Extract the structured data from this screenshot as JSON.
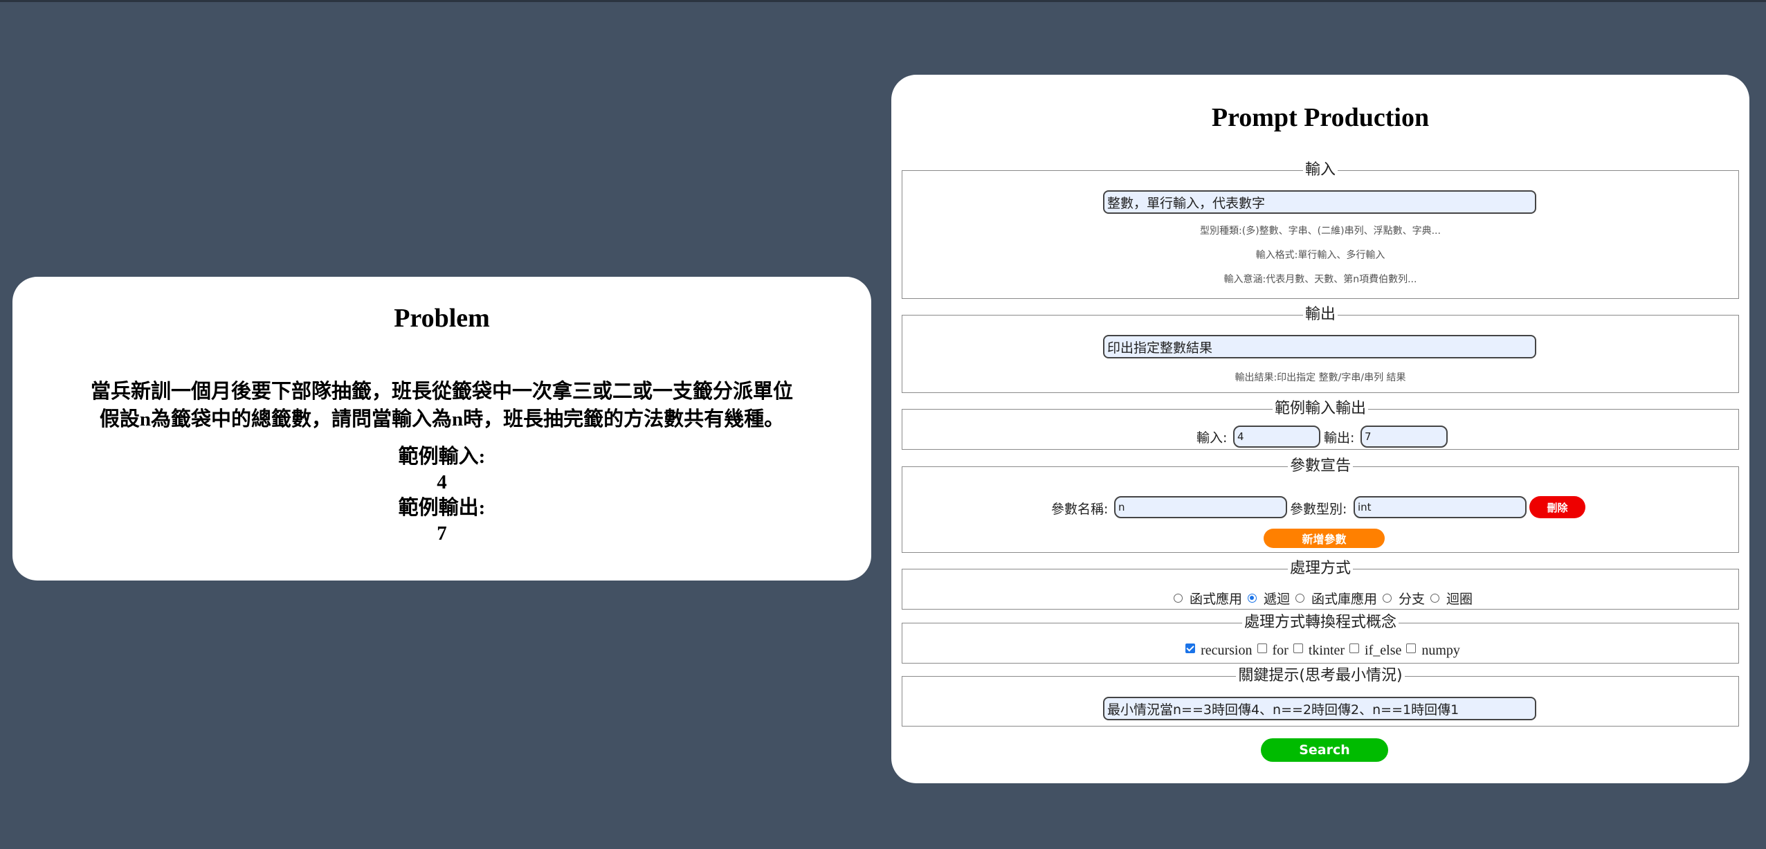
{
  "problem": {
    "title": "Problem",
    "line1": "當兵新訓一個月後要下部隊抽籤，班長從籤袋中一次拿三或二或一支籤分派單位",
    "line2": "假設n為籤袋中的總籤數，請問當輸入為n時，班長抽完籤的方法數共有幾種。",
    "example_input_label": "範例輸入:",
    "example_input_value": "4",
    "example_output_label": "範例輸出:",
    "example_output_value": "7"
  },
  "prompt": {
    "title": "Prompt Production",
    "input_section": {
      "legend": "輸入",
      "value": "整數，單行輸入，代表數字",
      "hint1": "型別種類:(多)整數、字串、(二維)串列、浮點數、字典...",
      "hint2": "輸入格式:單行輸入、多行輸入",
      "hint3": "輸入意涵:代表月數、天數、第n項費伯數列..."
    },
    "output_section": {
      "legend": "輸出",
      "value": "印出指定整數結果",
      "hint": "輸出結果:印出指定 整數/字串/串列 結果"
    },
    "example_section": {
      "legend": "範例輸入輸出",
      "input_label": "輸入:",
      "input_value": "4",
      "output_label": "輸出:",
      "output_value": "7"
    },
    "param_section": {
      "legend": "參數宣告",
      "name_label": "參數名稱:",
      "name_value": "n",
      "type_label": "參數型別:",
      "type_value": "int",
      "delete_label": "刪除",
      "add_label": "新增參數"
    },
    "method_section": {
      "legend": "處理方式",
      "options": [
        "函式應用",
        "遞迴",
        "函式庫應用",
        "分支",
        "迴圈"
      ],
      "selected": "遞迴"
    },
    "concept_section": {
      "legend": "處理方式轉換程式概念",
      "options": [
        {
          "label": "recursion",
          "checked": true
        },
        {
          "label": "for",
          "checked": false
        },
        {
          "label": "tkinter",
          "checked": false
        },
        {
          "label": "if_else",
          "checked": false
        },
        {
          "label": "numpy",
          "checked": false
        }
      ]
    },
    "hint_section": {
      "legend": "關鍵提示(思考最小情況)",
      "value": "最小情況當n==3時回傳4、n==2時回傳2、n==1時回傳1"
    },
    "search_label": "Search"
  },
  "colors": {
    "background": "#435163",
    "delete_button": "#ee0000",
    "add_button": "#ff8000",
    "search_button": "#00bb00",
    "input_fill": "#e8f0fe"
  }
}
